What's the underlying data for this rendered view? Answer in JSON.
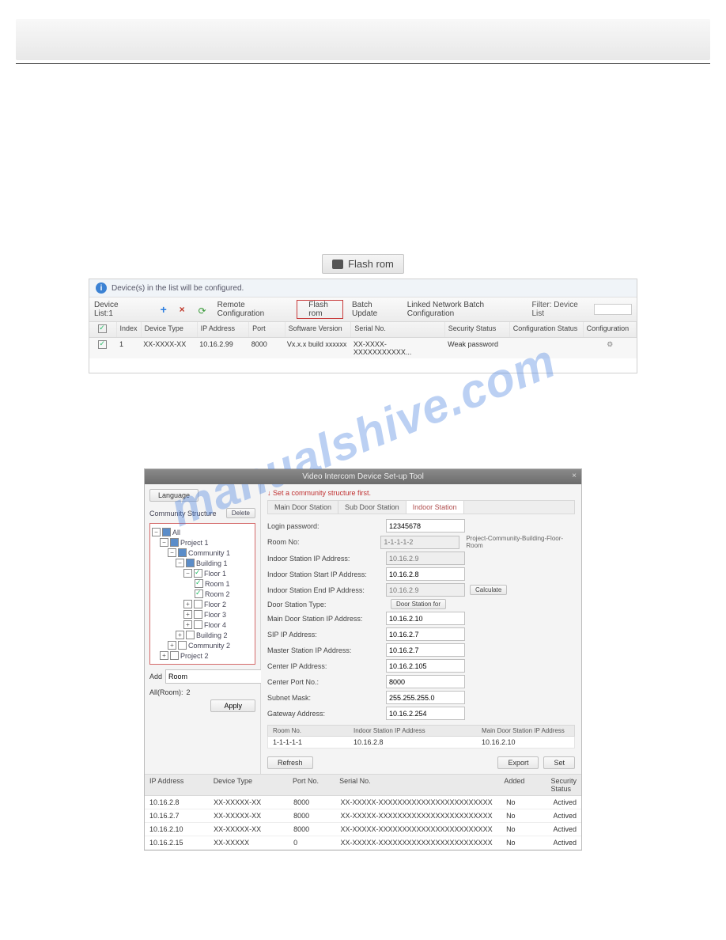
{
  "watermark": "manualshive.com",
  "flash_button": "Flash rom",
  "panel1": {
    "info": "Device(s) in the list will be configured.",
    "device_list_label": "Device List:1",
    "toolbar": {
      "remote_config": "Remote Configuration",
      "flash_rom": "Flash rom",
      "batch_update": "Batch Update",
      "linked_batch": "Linked Network Batch Configuration",
      "filter_label": "Filter: Device List"
    },
    "columns": {
      "index": "Index",
      "device_type": "Device Type",
      "ip": "IP Address",
      "port": "Port",
      "sw": "Software Version",
      "sn": "Serial No.",
      "sec": "Security Status",
      "cfg_status": "Configuration Status",
      "cfg": "Configuration"
    },
    "row": {
      "index": "1",
      "device_type": "XX-XXXX-XX",
      "ip": "10.16.2.99",
      "port": "8000",
      "sw": "Vx.x.x build xxxxxx",
      "sn": "XX-XXXX-XXXXXXXXXXX...",
      "sec": "Weak password"
    }
  },
  "panel2": {
    "title": "Video Intercom Device Set-up Tool",
    "language_btn": "Language",
    "cs_label": "Community Structure",
    "delete_btn": "Delete",
    "hint": "Set a community structure first.",
    "tree": {
      "all": "All",
      "p1": "Project 1",
      "c1": "Community 1",
      "b1": "Building 1",
      "f1": "Floor 1",
      "r1": "Room 1",
      "r2": "Room 2",
      "f2": "Floor 2",
      "f3": "Floor 3",
      "f4": "Floor 4",
      "b2": "Building 2",
      "c2": "Community 2",
      "p2": "Project 2"
    },
    "add_label": "Add",
    "add_value": "Room",
    "allroom_label": "All(Room):",
    "allroom_value": "2",
    "apply_btn": "Apply",
    "tabs": {
      "main": "Main Door Station",
      "sub": "Sub Door Station",
      "indoor": "Indoor Station"
    },
    "form": {
      "login_pw_l": "Login password:",
      "login_pw": "12345678",
      "room_no_l": "Room No:",
      "room_no": "1-1-1-1-2",
      "room_hint": "Project-Community-Building-Floor-Room",
      "ind_ip_l": "Indoor Station IP Address:",
      "ind_ip": "10.16.2.9",
      "start_ip_l": "Indoor Station Start IP Address:",
      "start_ip": "10.16.2.8",
      "end_ip_l": "Indoor Station End IP Address:",
      "end_ip": "10.16.2.9",
      "calc_btn": "Calculate",
      "ds_type_l": "Door Station Type:",
      "ds_type": "Door Station for",
      "main_ds_ip_l": "Main Door Station IP Address:",
      "main_ds_ip": "10.16.2.10",
      "sip_l": "SIP IP Address:",
      "sip": "10.16.2.7",
      "master_l": "Master Station IP Address:",
      "master": "10.16.2.7",
      "center_ip_l": "Center IP Address:",
      "center_ip": "10.16.2.105",
      "center_port_l": "Center Port No.:",
      "center_port": "8000",
      "subnet_l": "Subnet Mask:",
      "subnet": "255.255.255.0",
      "gw_l": "Gateway Address:",
      "gw": "10.16.2.254"
    },
    "subtable": {
      "h1": "Room No.",
      "h2": "Indoor Station IP Address",
      "h3": "Main Door Station IP Address",
      "r1c1": "1-1-1-1-1",
      "r1c2": "10.16.2.8",
      "r1c3": "10.16.2.10"
    },
    "refresh_btn": "Refresh",
    "export_btn": "Export",
    "set_btn": "Set",
    "btable": {
      "h_ip": "IP Address",
      "h_dt": "Device Type",
      "h_port": "Port No.",
      "h_sn": "Serial No.",
      "h_added": "Added",
      "h_sec": "Security Status",
      "rows": [
        {
          "ip": "10.16.2.8",
          "dt": "XX-XXXXX-XX",
          "port": "8000",
          "sn": "XX-XXXXX-XXXXXXXXXXXXXXXXXXXXXXXX",
          "added": "No",
          "sec": "Actived"
        },
        {
          "ip": "10.16.2.7",
          "dt": "XX-XXXXX-XX",
          "port": "8000",
          "sn": "XX-XXXXX-XXXXXXXXXXXXXXXXXXXXXXXX",
          "added": "No",
          "sec": "Actived"
        },
        {
          "ip": "10.16.2.10",
          "dt": "XX-XXXXX-XX",
          "port": "8000",
          "sn": "XX-XXXXX-XXXXXXXXXXXXXXXXXXXXXXXX",
          "added": "No",
          "sec": "Actived"
        },
        {
          "ip": "10.16.2.15",
          "dt": "XX-XXXXX",
          "port": "0",
          "sn": "XX-XXXXX-XXXXXXXXXXXXXXXXXXXXXXXX",
          "added": "No",
          "sec": "Actived"
        }
      ]
    }
  }
}
